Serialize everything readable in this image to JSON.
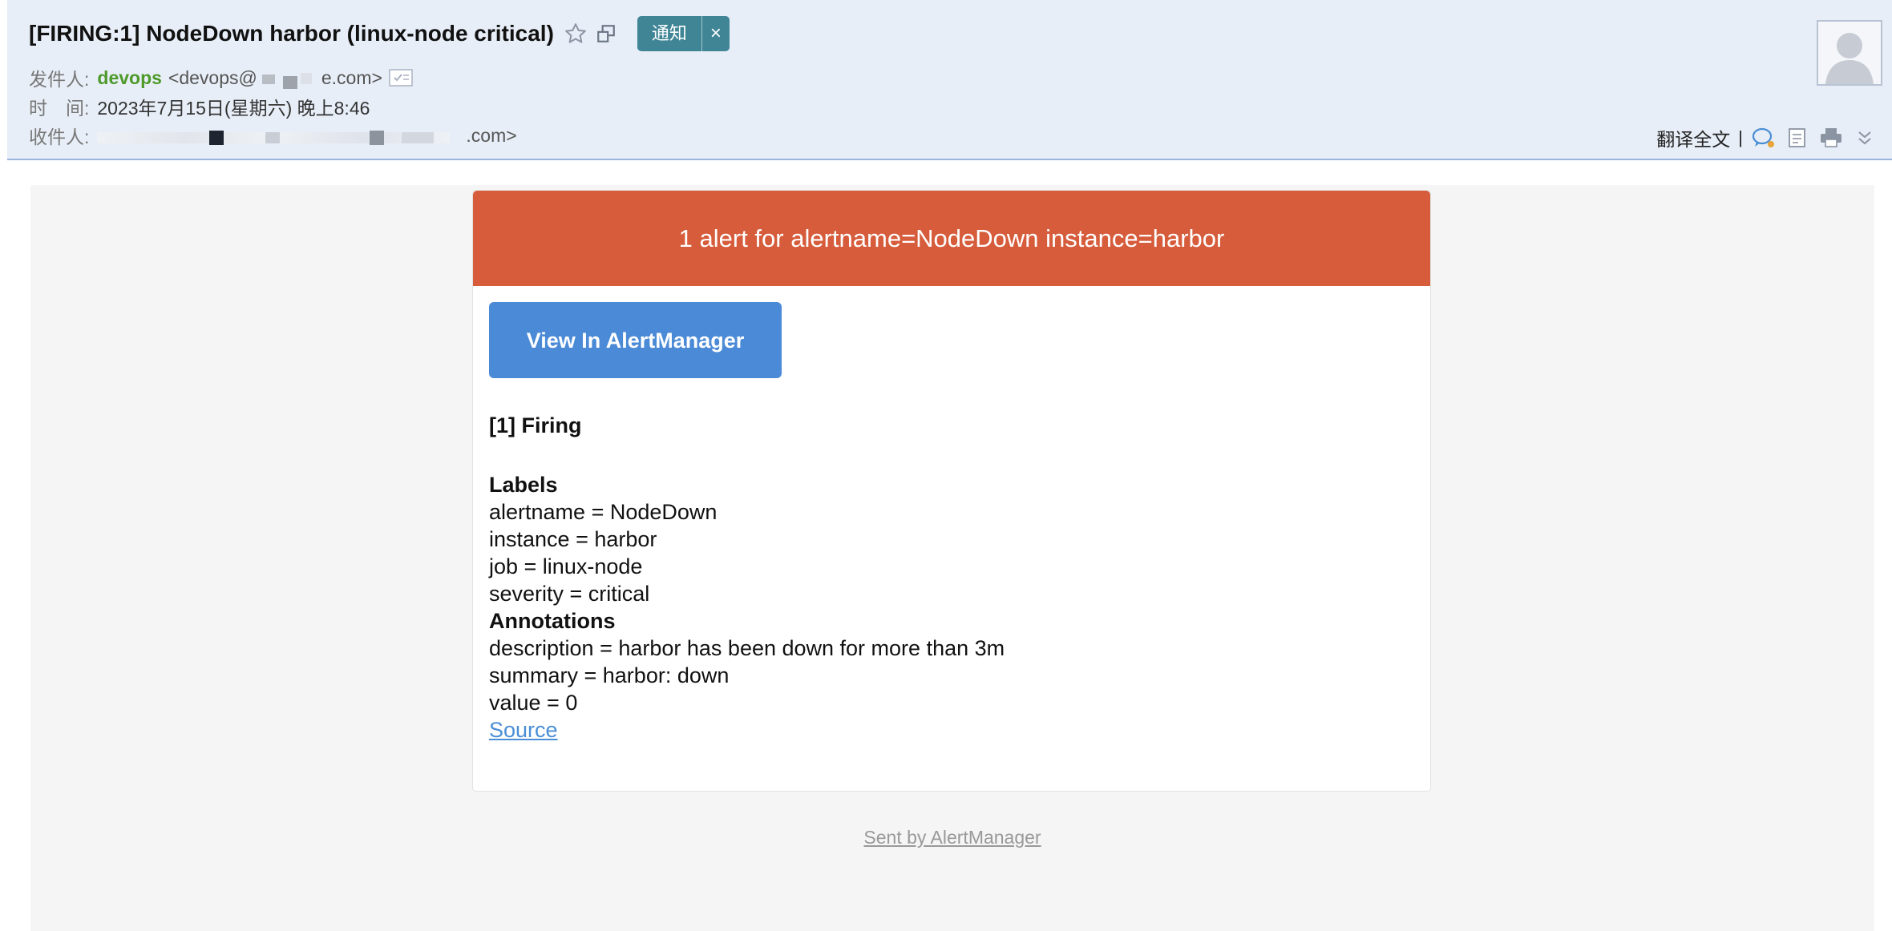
{
  "header": {
    "subject": "[FIRING:1] NodeDown harbor (linux-node critical)",
    "tag_label": "通知",
    "tag_close": "×",
    "from_label": "发件人:",
    "sender_name": "devops",
    "sender_addr_prefix": "<devops@",
    "sender_addr_suffix": "e.com>",
    "time_label": "时　间:",
    "time_value": "2023年7月15日(星期六) 晚上8:46",
    "to_label": "收件人:",
    "to_addr_suffix": ".com>",
    "translate_label": "翻译全文",
    "tool_separator": "|"
  },
  "alert": {
    "banner": "1 alert for alertname=NodeDown instance=harbor",
    "button_label": "View In AlertManager",
    "firing_title": "[1] Firing",
    "labels_title": "Labels",
    "labels": [
      "alertname = NodeDown",
      "instance = harbor",
      "job = linux-node",
      "severity = critical"
    ],
    "annotations_title": "Annotations",
    "annotations": [
      "description = harbor has been down for more than 3m",
      "summary = harbor: down",
      "value = 0"
    ],
    "source_label": "Source"
  },
  "footer": {
    "sent_by": "Sent by AlertManager"
  },
  "colors": {
    "banner": "#d65c3b",
    "button": "#4b8ad6",
    "sender_name": "#4d9a2a",
    "tag": "#3f8596",
    "header_bg": "#e8eef7"
  },
  "icons": [
    "star-icon",
    "popout-icon",
    "close-icon",
    "verify-icon",
    "avatar-icon",
    "chat-icon",
    "note-icon",
    "print-icon",
    "chevron-down-icon"
  ]
}
